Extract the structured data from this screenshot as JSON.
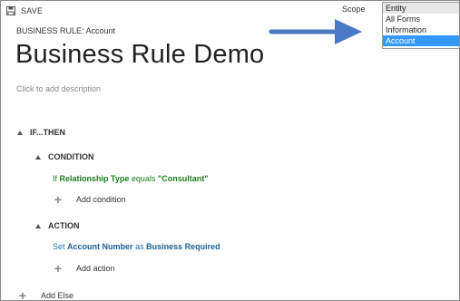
{
  "toolbar": {
    "save_label": "SAVE"
  },
  "header": {
    "breadcrumb": "BUSINESS RULE: Account",
    "title": "Business Rule Demo",
    "description_placeholder": "Click to add description"
  },
  "scope": {
    "label": "Scope",
    "options": [
      "Entity",
      "All Forms",
      "Information",
      "Account"
    ],
    "selected": "Account"
  },
  "annotation": {
    "arrow_color": "#4a78c2"
  },
  "rule": {
    "if_then_label": "IF...THEN",
    "condition": {
      "header": "CONDITION",
      "prefix": "If",
      "field": "Relationship Type",
      "operator": "equals",
      "value": "\"Consultant\"",
      "add_label": "Add condition"
    },
    "action": {
      "header": "ACTION",
      "verb": "Set",
      "field": "Account Number",
      "as_word": "as",
      "target": "Business Required",
      "add_label": "Add action"
    },
    "add_else_label": "Add Else"
  },
  "colors": {
    "condition_text": "#1e7d1e",
    "action_text": "#1e6fae",
    "selected_option_bg": "#3399ff"
  }
}
